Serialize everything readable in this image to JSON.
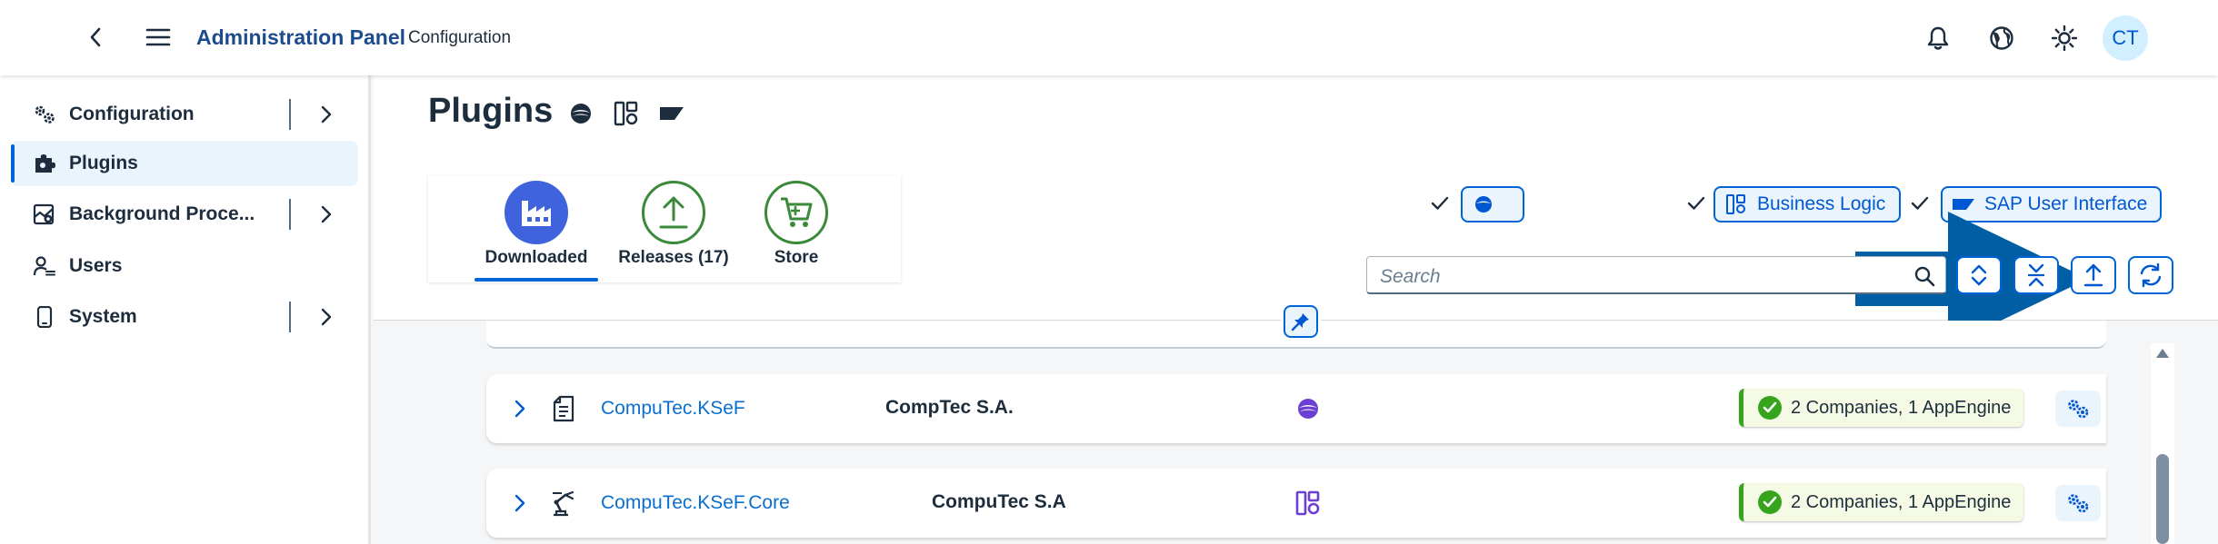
{
  "shellbar": {
    "title": "Administration Panel",
    "subtitle": "Configuration",
    "icons": [
      "chevron-left-icon",
      "menu-icon",
      "bell-icon",
      "globe-icon",
      "sun-icon"
    ],
    "avatar_initials": "CT"
  },
  "sidebar": {
    "items": [
      {
        "label": "Configuration",
        "icon": "gears-icon",
        "expandable": true,
        "active": false
      },
      {
        "label": "Plugins",
        "icon": "puzzle-icon",
        "expandable": false,
        "active": true
      },
      {
        "label": "Background Proce...",
        "icon": "background-process-icon",
        "expandable": true,
        "active": false
      },
      {
        "label": "Users",
        "icon": "users-icon",
        "expandable": false,
        "active": false
      },
      {
        "label": "System",
        "icon": "device-icon",
        "expandable": true,
        "active": false
      }
    ]
  },
  "page": {
    "title": "Plugins",
    "title_icons": [
      "eclipse-icon",
      "business-logic-icon",
      "tag-icon"
    ]
  },
  "tabs": [
    {
      "label": "Downloaded",
      "icon": "factory-icon",
      "selected": true
    },
    {
      "label": "Releases (17)",
      "icon": "upload-icon",
      "selected": false
    },
    {
      "label": "Store",
      "icon": "cart-icon",
      "selected": false
    }
  ],
  "filters": [
    {
      "label": "",
      "icon": "eclipse-icon",
      "checked": true
    },
    {
      "label": "Business Logic",
      "icon": "business-logic-icon",
      "checked": true
    },
    {
      "label": "SAP User Interface",
      "icon": "tag-icon",
      "checked": true
    }
  ],
  "search": {
    "placeholder": "Search"
  },
  "toolbar": [
    "expand-all-icon",
    "collapse-all-icon",
    "upload-icon",
    "refresh-icon"
  ],
  "plugins": [
    {
      "name": "CompuTec.KSeF",
      "vendor": "CompTec S.A.",
      "icon": "document-icon",
      "type_icon": "eclipse-icon",
      "status": "2 Companies, 1 AppEngine"
    },
    {
      "name": "CompuTec.KSeF.Core",
      "vendor": "CompuTec S.A",
      "icon": "robot-arm-icon",
      "type_icon": "business-logic-icon",
      "status": "2 Companies, 1 AppEngine"
    }
  ],
  "colors": {
    "accent": "#0064d9",
    "brand_title": "#1d4b8f",
    "link": "#0a6ed1",
    "success": "#36a41d",
    "tab_selected": "#3e63dd",
    "tab_outline": "#3a8a3a",
    "annotation_arrow": "#005ea5",
    "type_icon": "#6b3fd4"
  }
}
